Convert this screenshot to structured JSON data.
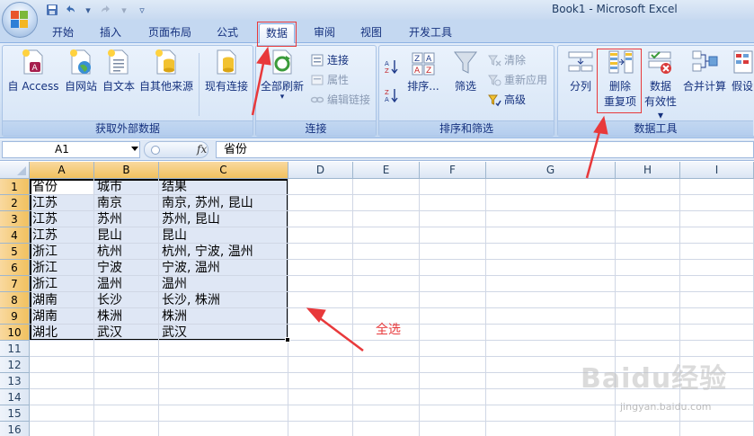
{
  "window": {
    "title": "Book1 - Microsoft Excel"
  },
  "tabs": [
    "开始",
    "插入",
    "页面布局",
    "公式",
    "数据",
    "审阅",
    "视图",
    "开发工具"
  ],
  "active_tab": "数据",
  "ribbon": {
    "get_external": {
      "label": "获取外部数据",
      "buttons": [
        "自 Access",
        "自网站",
        "自文本",
        "自其他来源",
        "现有连接"
      ]
    },
    "connections": {
      "label": "连接",
      "refresh_all": "全部刷新",
      "connections": "连接",
      "properties": "属性",
      "edit_links": "编辑链接"
    },
    "sort_filter": {
      "label": "排序和筛选",
      "sort": "排序...",
      "filter": "筛选",
      "clear": "清除",
      "reapply": "重新应用",
      "advanced": "高级"
    },
    "data_tools": {
      "label": "数据工具",
      "split": "分列",
      "remove_dup_1": "删除",
      "remove_dup_2": "重复项",
      "validation_1": "数据",
      "validation_2": "有效性",
      "consolidate": "合并计算",
      "whatif": "假设"
    }
  },
  "formula_bar": {
    "name_box": "A1",
    "fx": "fx",
    "content": "省份"
  },
  "grid": {
    "columns": [
      "A",
      "B",
      "C",
      "D",
      "E",
      "F",
      "G",
      "H",
      "I"
    ],
    "rows": [
      "1",
      "2",
      "3",
      "4",
      "5",
      "6",
      "7",
      "8",
      "9",
      "10",
      "11",
      "12",
      "13",
      "14",
      "15",
      "16"
    ],
    "data": [
      [
        "省份",
        "城市",
        "结果"
      ],
      [
        "江苏",
        "南京",
        "南京, 苏州, 昆山"
      ],
      [
        "江苏",
        "苏州",
        "苏州, 昆山"
      ],
      [
        "江苏",
        "昆山",
        "昆山"
      ],
      [
        "浙江",
        "杭州",
        "杭州, 宁波, 温州"
      ],
      [
        "浙江",
        "宁波",
        "宁波, 温州"
      ],
      [
        "浙江",
        "温州",
        "温州"
      ],
      [
        "湖南",
        "长沙",
        "长沙, 株洲"
      ],
      [
        "湖南",
        "株洲",
        "株洲"
      ],
      [
        "湖北",
        "武汉",
        "武汉"
      ]
    ]
  },
  "annotation": {
    "select_all": "全选"
  },
  "watermark": {
    "logo": "Baidu经验",
    "sub": "jingyan.baidu.com"
  },
  "colors": {
    "accent_red": "#e8393b",
    "selection": "#c4d3ec"
  }
}
